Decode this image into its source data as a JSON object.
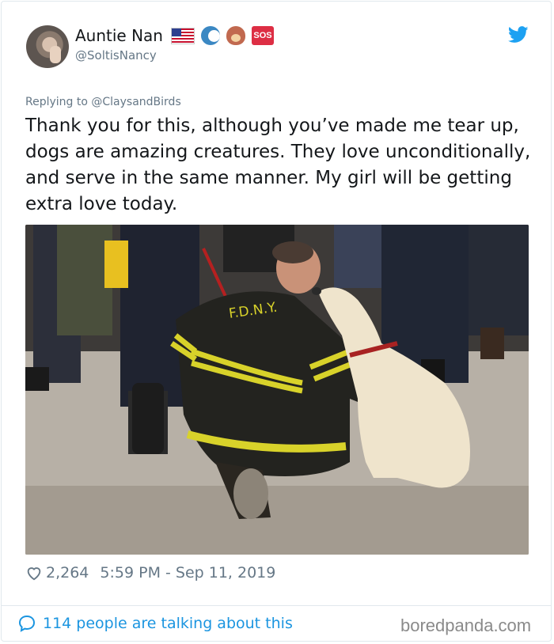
{
  "tweet": {
    "author_name": "Auntie Nan",
    "author_handle": "@SoltisNancy",
    "reply_prefix": "Replying to",
    "reply_to": "@ClaysandBirds",
    "text": "Thank you for this, although you’ve made me tear up, dogs are amazing creatures. They love unconditionally, and serve in the same manner. My girl will be getting extra love today.",
    "likes": "2,264",
    "timestamp": "5:59 PM - Sep 11, 2019",
    "emoji": [
      "us-flag-icon",
      "wave-icon",
      "dog-face-icon",
      "sos-icon"
    ],
    "sos_label": "SOS"
  },
  "photo": {
    "jacket_text": "F.D.N.Y."
  },
  "footer": {
    "talking": "114 people are talking about this",
    "watermark": "boredpanda.com"
  },
  "colors": {
    "twitter_blue": "#1da1f2",
    "link_blue": "#1b95e0",
    "text": "#14171a",
    "muted": "#657786"
  }
}
